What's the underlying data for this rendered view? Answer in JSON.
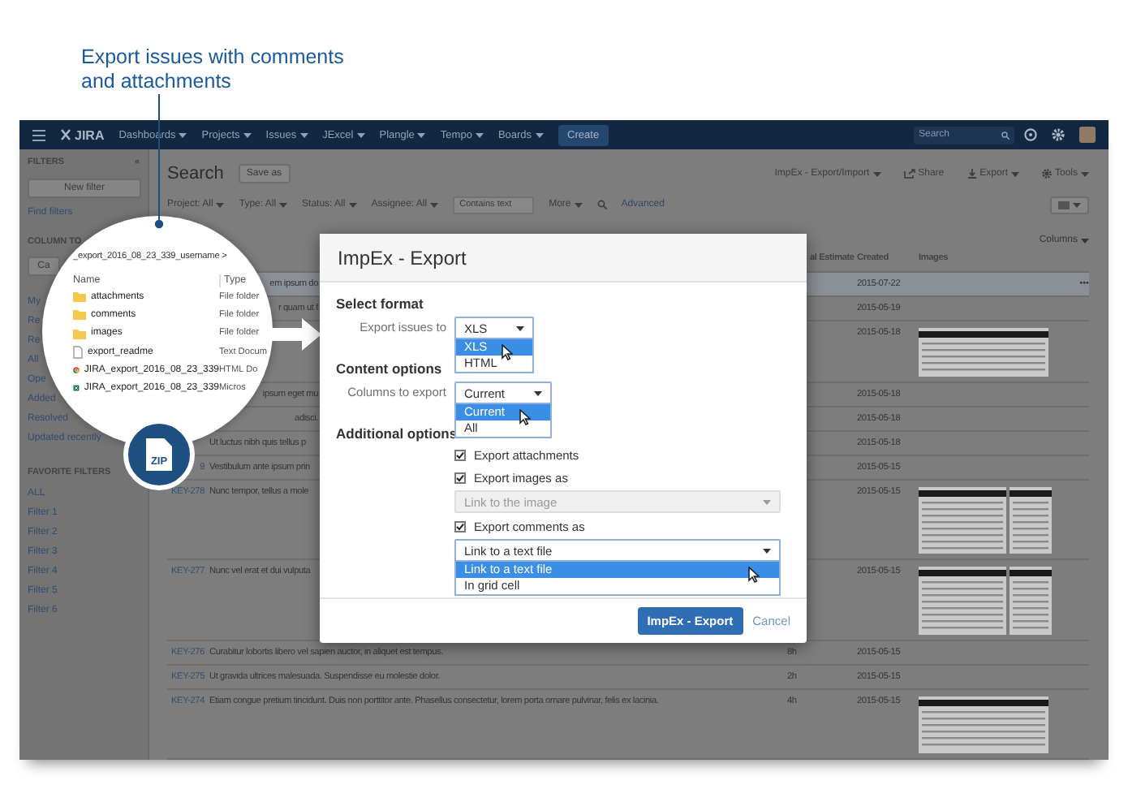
{
  "caption": {
    "text": "Export issues with comments and attachments"
  },
  "navbar": {
    "logo": "JIRA",
    "menus": [
      "Dashboards",
      "Projects",
      "Issues",
      "JExcel",
      "Plangle",
      "Tempo",
      "Boards"
    ],
    "create": "Create",
    "search": {
      "placeholder": "Search"
    }
  },
  "sidebar": {
    "title": "FILTERS",
    "collapse": "«",
    "new_filter": "New filter",
    "find_filters": "Find filters",
    "column_heading": "COLUMN TO",
    "column_button": "Ca",
    "items": [
      "My",
      "Re",
      "Re",
      "All",
      "Ope",
      "Added",
      "Resolved",
      "Updated recently"
    ],
    "favorites_title": "FAVORITE FILTERS",
    "favorites": [
      "ALL",
      "Filter 1",
      "Filter 2",
      "Filter 3",
      "Filter 4",
      "Filter 5",
      "Filter 6"
    ]
  },
  "search": {
    "title": "Search",
    "save_as": "Save as",
    "actions": [
      {
        "label": "ImpEx - Export/Import",
        "kind": "menu"
      },
      {
        "label": "Share",
        "kind": "share"
      },
      {
        "label": "Export",
        "kind": "export"
      },
      {
        "label": "Tools",
        "kind": "tools"
      }
    ],
    "filters": [
      "Project: All",
      "Type: All",
      "Status: All",
      "Assignee: All"
    ],
    "text_filter": {
      "placeholder": "Contains text"
    },
    "more": "More",
    "advanced": "Advanced",
    "columns_button": "Columns"
  },
  "table": {
    "columns": [
      "al Estimate",
      "Created",
      "Images"
    ],
    "rows": [
      {
        "kind": "partial",
        "summary": "em ipsum do",
        "created": "2015-07-22",
        "selected": true,
        "actions": "•••"
      },
      {
        "kind": "partial",
        "summary": "r quam ut f",
        "created": "2015-05-19",
        "selected": false
      },
      {
        "kind": "partial",
        "created": "2015-05-18",
        "selected": false,
        "images": [
          {
            "kind": "screenshot"
          }
        ]
      },
      {
        "kind": "partial",
        "summary": "ipsum eget mu",
        "created": "2015-05-18",
        "selected": false
      },
      {
        "kind": "partial",
        "summary": "adisci.",
        "created": "2015-05-18",
        "selected": false
      },
      {
        "kind": "full",
        "summary": "Ut luctus nibh quis tellus p",
        "created": "2015-05-18",
        "selected": false
      },
      {
        "kind": "full",
        "key": "9",
        "summary": "Vestibulum ante ipsum prin",
        "created": "2015-05-15",
        "selected": false
      },
      {
        "kind": "full",
        "key": "KEY-278",
        "summary": "Nunc tempor, tellus a mole",
        "created": "2015-05-15",
        "selected": false,
        "images": [
          {
            "kind": "screenshot"
          },
          {
            "kind": "screenshot"
          }
        ]
      },
      {
        "kind": "full",
        "key": "KEY-277",
        "summary": "Nunc vel erat et dui vulputa",
        "created": "2015-05-15",
        "selected": false,
        "images": [
          {
            "kind": "screenshot"
          },
          {
            "kind": "screenshot"
          }
        ]
      },
      {
        "kind": "full",
        "key": "KEY-276",
        "summary": "Curabitur lobortis libero vel sapien auctor, in aliquet est tempus.",
        "estimate": "8h",
        "created": "2015-05-15",
        "selected": false
      },
      {
        "kind": "full",
        "key": "KEY-275",
        "summary": "Ut gravida ultrices malesuada. Suspendisse eu molestie dolor.",
        "estimate": "2h",
        "created": "2015-05-15",
        "selected": false
      },
      {
        "kind": "full",
        "key": "KEY-274",
        "summary": "Etiam congue pretium tincidunt. Duis non porttitor ante. Phasellus consectetur, lorem porta ornare pulvinar, felis ex lacinia.",
        "estimate": "4h",
        "created": "2015-05-15",
        "selected": false,
        "images": [
          {
            "kind": "screenshot"
          }
        ]
      }
    ]
  },
  "lens": {
    "path": "_export_2016_08_23_339_username >",
    "columns": [
      "Name",
      "Type"
    ],
    "files": [
      {
        "kind": "folder",
        "name": "attachments",
        "type": "File folder"
      },
      {
        "kind": "folder",
        "name": "comments",
        "type": "File folder"
      },
      {
        "kind": "folder",
        "name": "images",
        "type": "File folder"
      },
      {
        "kind": "text",
        "name": "export_readme",
        "type": "Text Docum"
      },
      {
        "kind": "browser",
        "name": "JIRA_export_2016_08_23_339",
        "type": "HTML Do"
      },
      {
        "kind": "spreadsheet",
        "name": "JIRA_export_2016_08_23_339",
        "type": "Micros"
      }
    ],
    "badge": "ZIP"
  },
  "dialog": {
    "title": "ImpEx - Export",
    "sections": [
      {
        "heading": "Select format",
        "fields": [
          {
            "kind": "select",
            "label": "Export issues to",
            "value": "XLS",
            "disabled": false,
            "options": [
              {
                "label": "XLS",
                "selected": true
              },
              {
                "label": "HTML",
                "selected": false
              }
            ]
          }
        ]
      },
      {
        "heading": "Content options",
        "fields": [
          {
            "kind": "select",
            "label": "Columns to export",
            "value": "Current",
            "disabled": false,
            "options": [
              {
                "label": "Current",
                "selected": true
              },
              {
                "label": "All",
                "selected": false
              }
            ]
          }
        ]
      },
      {
        "heading": "Additional options",
        "fields": [
          {
            "kind": "checkbox",
            "label": "Export attachments",
            "checked": true
          },
          {
            "kind": "checkbox",
            "label": "Export images as",
            "checked": true
          },
          {
            "kind": "select",
            "value": "Link to the image",
            "disabled": true
          },
          {
            "kind": "checkbox",
            "label": "Export comments as",
            "checked": true
          },
          {
            "kind": "select",
            "value": "Link to a text file",
            "disabled": false,
            "options": [
              {
                "label": "Link to a text file",
                "selected": true
              },
              {
                "label": "In grid cell",
                "selected": false
              }
            ]
          }
        ]
      }
    ],
    "submit": "ImpEx - Export",
    "cancel": "Cancel"
  }
}
